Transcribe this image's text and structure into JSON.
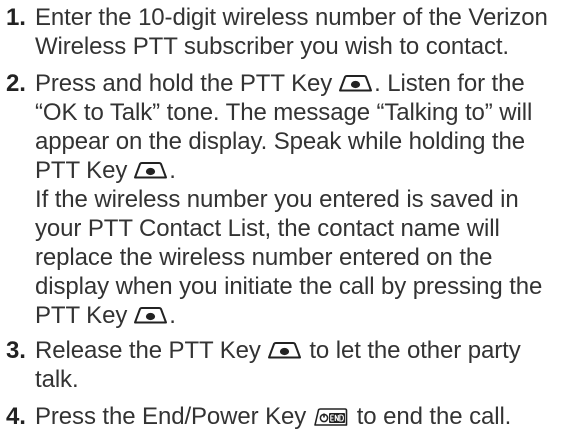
{
  "steps": [
    {
      "number": "1.",
      "lines": [
        "Enter the 10-digit wireless number of the Verizon",
        "Wireless PTT subscriber you wish to contact."
      ]
    },
    {
      "number": "2.",
      "line1_before": "Press and hold the PTT Key",
      "line1_after": ". Listen for the",
      "line2": "“OK to Talk” tone. The message “Talking to” will",
      "line3": "appear on the display. Speak while holding the",
      "line4_before": "PTT Key",
      "line4_after": ".",
      "para2_line1": "If the wireless number you entered is saved in",
      "para2_line2": "your PTT Contact List, the contact name will",
      "para2_line3": "replace the wireless number entered on the",
      "para2_line4": "display when you initiate the call by pressing the",
      "para2_line5_before": "PTT Key",
      "para2_line5_after": "."
    },
    {
      "number": "3.",
      "line1_before": "Release the PTT Key",
      "line1_after": " to let the other party",
      "line2": "talk."
    },
    {
      "number": "4.",
      "line1_before": "Press the End/Power Key",
      "line1_after": " to end the call."
    }
  ],
  "icons": {
    "ptt_key": "ptt-key-icon",
    "end_key": "end-power-key-icon"
  }
}
